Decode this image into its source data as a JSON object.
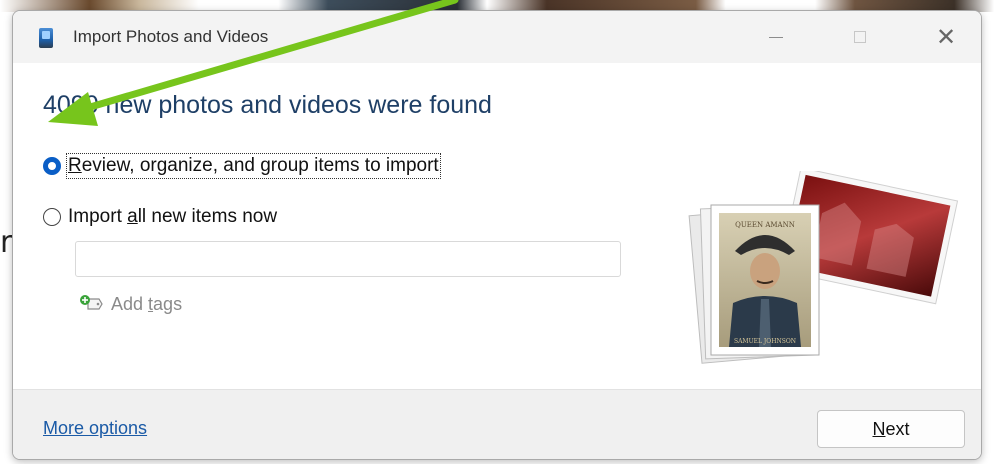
{
  "window": {
    "title": "Import Photos and Videos"
  },
  "heading": "4090 new photos and videos were found",
  "options": {
    "review": {
      "prefix": "",
      "accel": "R",
      "rest": "eview, organize, and group items to import",
      "selected": true
    },
    "import_all": {
      "prefix": "Import ",
      "accel": "a",
      "rest": "ll new items now",
      "selected": false
    }
  },
  "tags": {
    "input_value": "",
    "add_label_prefix": "Add ",
    "add_label_accel": "t",
    "add_label_rest": "ags"
  },
  "footer": {
    "more_options": "More options",
    "next_accel": "N",
    "next_rest": "ext"
  },
  "illustration": {
    "photo_caption_top": "QUEEN AMANN",
    "photo_caption_bottom": "SAMUEL JOHNSON"
  },
  "background": {
    "edge_letter": "r"
  },
  "colors": {
    "heading": "#1e3f66",
    "link": "#1a5aa6",
    "radio_selected": "#0a5ec6",
    "annotation_arrow": "#77c51c"
  },
  "icons": [
    "app-icon",
    "minimize-icon",
    "maximize-icon",
    "close-icon",
    "add-tag-icon",
    "annotation-arrow-icon"
  ]
}
